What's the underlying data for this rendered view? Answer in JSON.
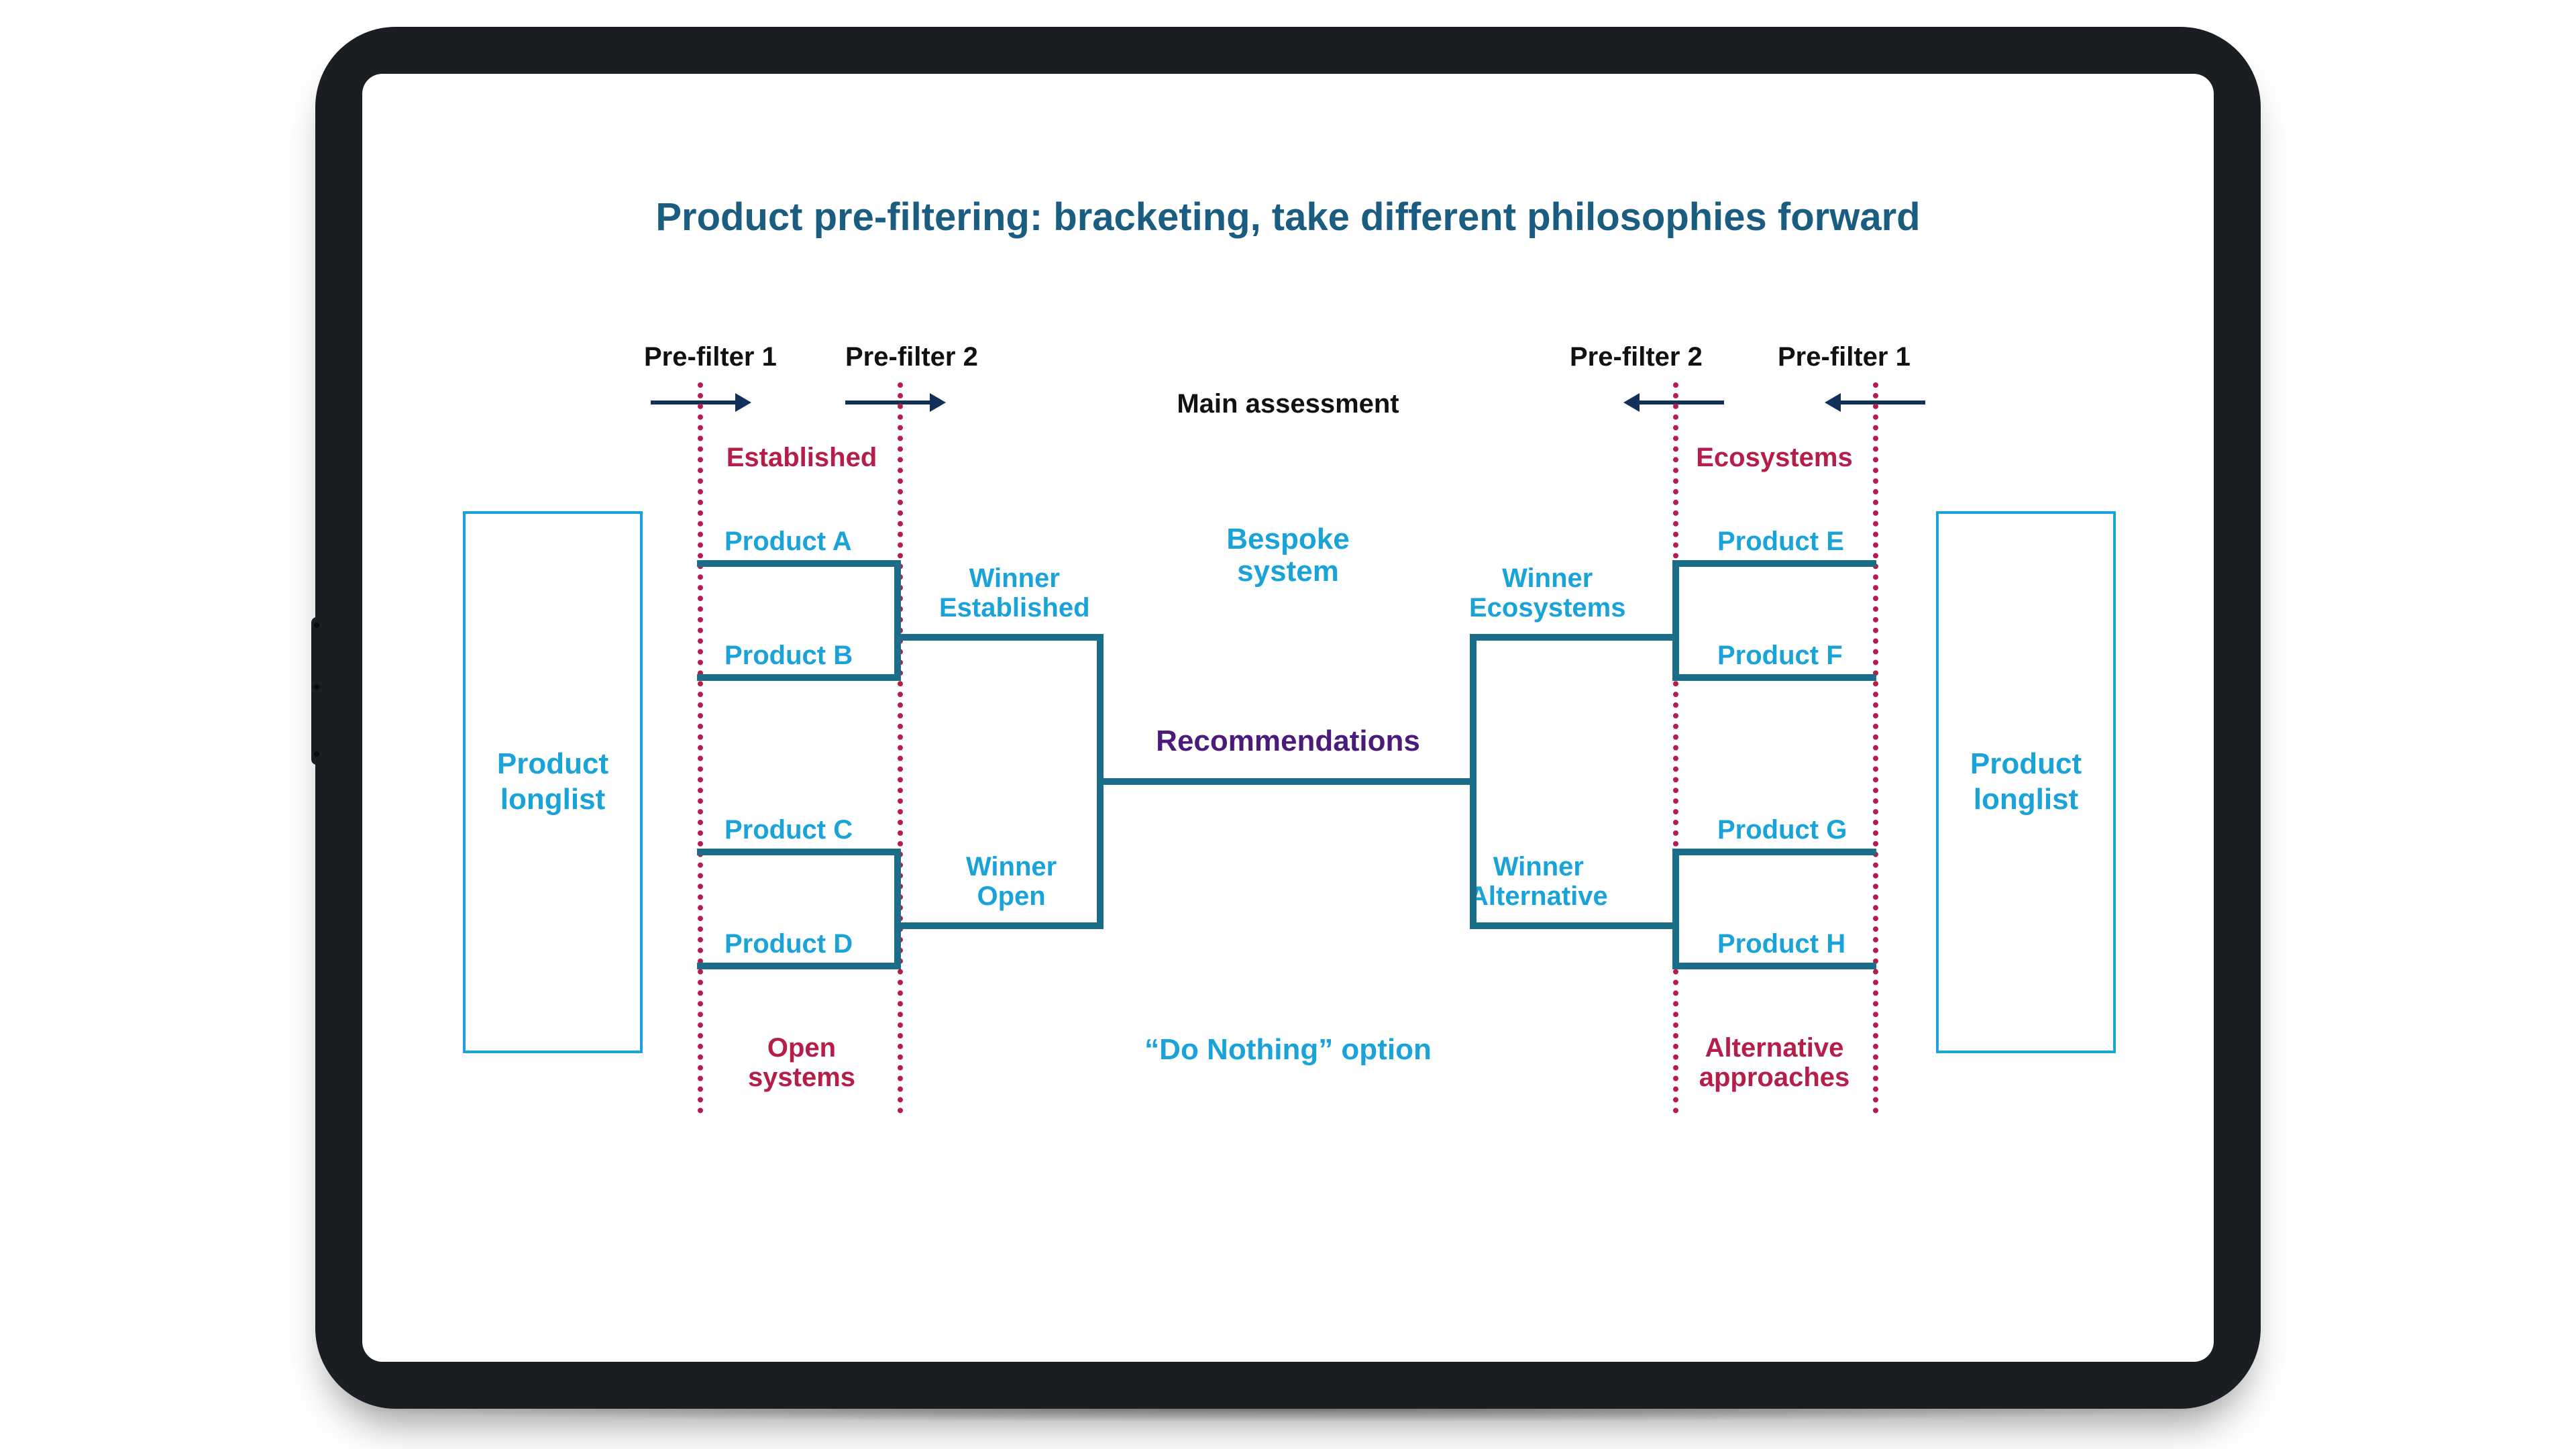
{
  "title": "Product pre-filtering: bracketing, take different philosophies forward",
  "headers": {
    "prefilter1": "Pre-filter 1",
    "prefilter2": "Pre-filter 2",
    "main": "Main assessment"
  },
  "left": {
    "longlist": "Product\nlonglist",
    "category_top": "Established",
    "category_bottom": "Open\nsystems",
    "products": {
      "a": "Product A",
      "b": "Product B",
      "c": "Product C",
      "d": "Product D"
    },
    "winners": {
      "top": "Winner\nEstablished",
      "bottom": "Winner\nOpen"
    }
  },
  "right": {
    "longlist": "Product\nlonglist",
    "category_top": "Ecosystems",
    "category_bottom": "Alternative\napproaches",
    "products": {
      "e": "Product E",
      "f": "Product F",
      "g": "Product G",
      "h": "Product H"
    },
    "winners": {
      "top": "Winner\nEcosystems",
      "bottom": "Winner\nAlternative"
    }
  },
  "center": {
    "top": "Bespoke\nsystem",
    "mid": "Recommendations",
    "bottom": "“Do Nothing” option"
  },
  "colors": {
    "title": "#1b5d80",
    "cyan": "#1aa3d9",
    "crimson": "#b61e4a",
    "purple": "#4b1b7a",
    "arrow": "#12315a",
    "bracket": "#1b6e8a"
  }
}
